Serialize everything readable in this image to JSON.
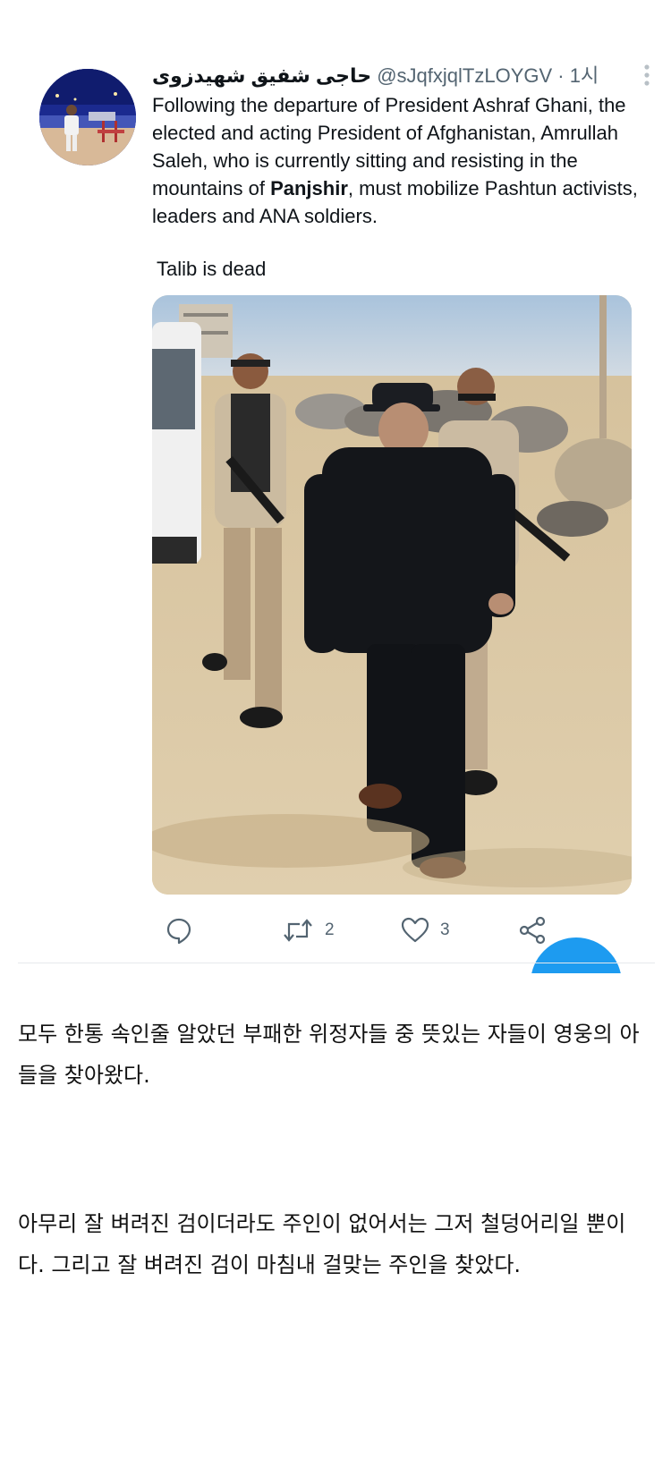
{
  "tweet": {
    "display_name": "حاجی شفیق شهیدزوی",
    "handle": "@sJqfxjqlTzLOYGV",
    "time": "· 1시",
    "text_before_bold": "Following the departure of President Ashraf Ghani, the elected and acting President of Afghanistan, Amrullah Saleh, who is currently sitting and resisting in the mountains of ",
    "text_bold": "Panjshir",
    "text_after_bold": ", must mobilize Pashtun activists, leaders and ANA soldiers.",
    "second_text": "Talib is dead",
    "retweet_count": "2",
    "like_count": "3"
  },
  "icons": {
    "reply": "comment-bubble-icon",
    "retweet": "retweet-arrows-icon",
    "like": "heart-icon",
    "share": "share-nodes-icon",
    "more": "vertical-dots-icon"
  },
  "colors": {
    "action_gray": "#536471",
    "accent_blue": "#1d9bf0",
    "text_primary": "#0f1419"
  },
  "article": {
    "paragraph_1": "모두 한통 속인줄 알았던 부패한 위정자들 중 뜻있는 자들이 영웅의 아들을 찾아왔다.",
    "paragraph_2": "아무리 잘 벼려진 검이더라도 주인이 없어서는 그저 철덩어리일 뿐이다. 그리고 잘 벼려진 검이 마침내 걸맞는 주인을 찾았다."
  }
}
